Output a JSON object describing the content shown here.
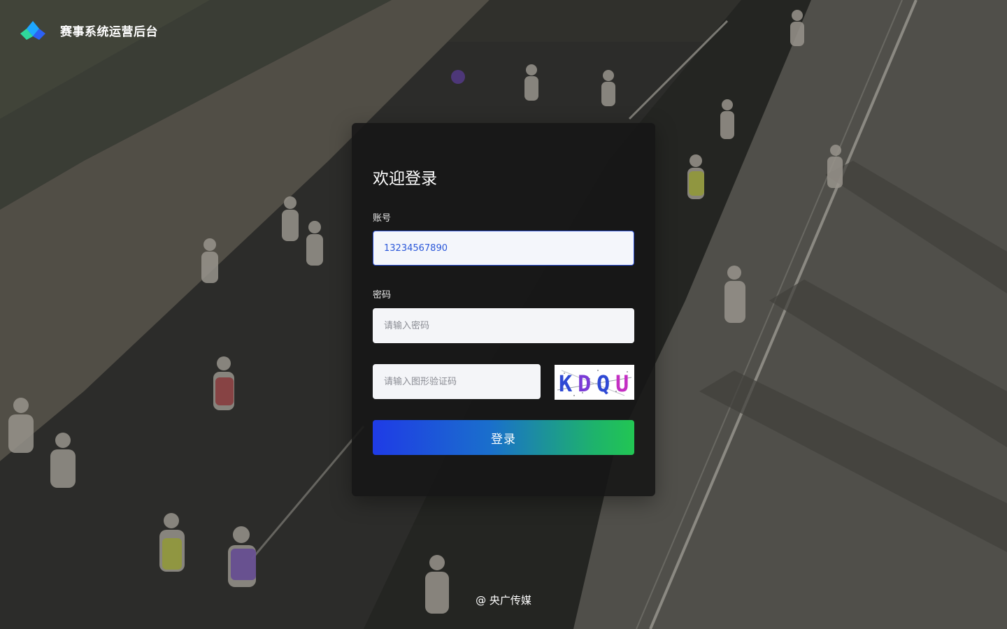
{
  "app": {
    "title": "赛事系统运营后台"
  },
  "login": {
    "heading": "欢迎登录",
    "account_label": "账号",
    "account_value": "13234567890",
    "password_label": "密码",
    "password_placeholder": "请输入密码",
    "captcha_placeholder": "请输入图形验证码",
    "captcha_text": "KDQU",
    "submit_label": "登录"
  },
  "footer": {
    "text": "@ 央广传媒"
  },
  "colors": {
    "card_bg": "#161616",
    "input_bg": "#f4f5f8",
    "focus_border": "#2b50d8",
    "button_gradient_start": "#1f3be6",
    "button_gradient_end": "#22c653"
  },
  "icons": {
    "logo": "diamond-logo-icon"
  }
}
